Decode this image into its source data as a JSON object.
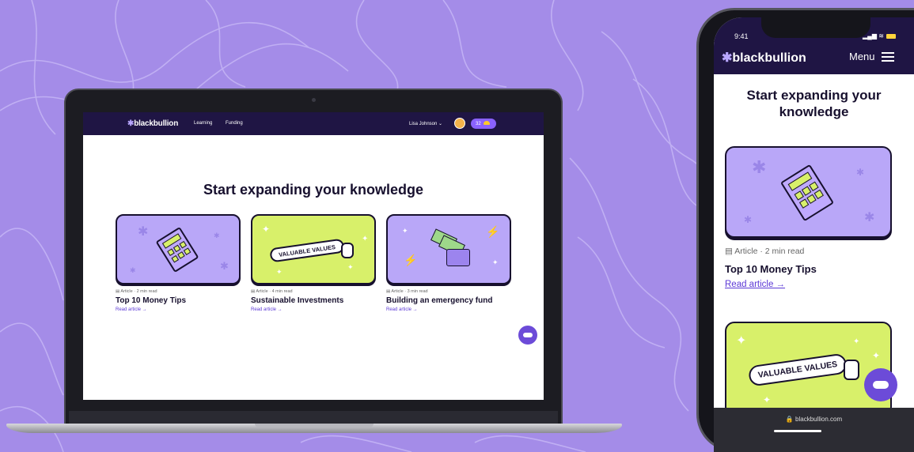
{
  "laptop": {
    "nav": {
      "logo_mark": "✱",
      "logo_text": "blackbullion",
      "links": [
        "Learning",
        "Funding"
      ],
      "user_name": "Lisa Johnson ⌄",
      "points": "32"
    },
    "heading": "Start expanding your knowledge",
    "cards": [
      {
        "meta": "Article · 2 min read",
        "title": "Top 10 Money Tips",
        "link": "Read article →"
      },
      {
        "meta": "Article · 4 min read",
        "title": "Sustainable Investments",
        "link": "Read article →",
        "banner": "VALUABLE VALUES"
      },
      {
        "meta": "Article · 3 min read",
        "title": "Building an emergency fund",
        "link": "Read article →"
      }
    ]
  },
  "phone": {
    "time": "9:41",
    "status": "▂▄▆ ≋",
    "logo_mark": "✱",
    "logo_text": "blackbullion",
    "menu_label": "Menu",
    "heading": "Start expanding your knowledge",
    "card": {
      "meta": "Article · 2 min read",
      "title": "Top 10 Money Tips",
      "link": "Read article →"
    },
    "second_card_banner": "VALUABLE VALUES",
    "url": "🔒 blackbullion.com"
  },
  "colors": {
    "background": "#a48ce8",
    "nav": "#1f1544",
    "accent": "#6c4bd8",
    "lime": "#d8f06a",
    "lilac": "#b9a7f8"
  }
}
